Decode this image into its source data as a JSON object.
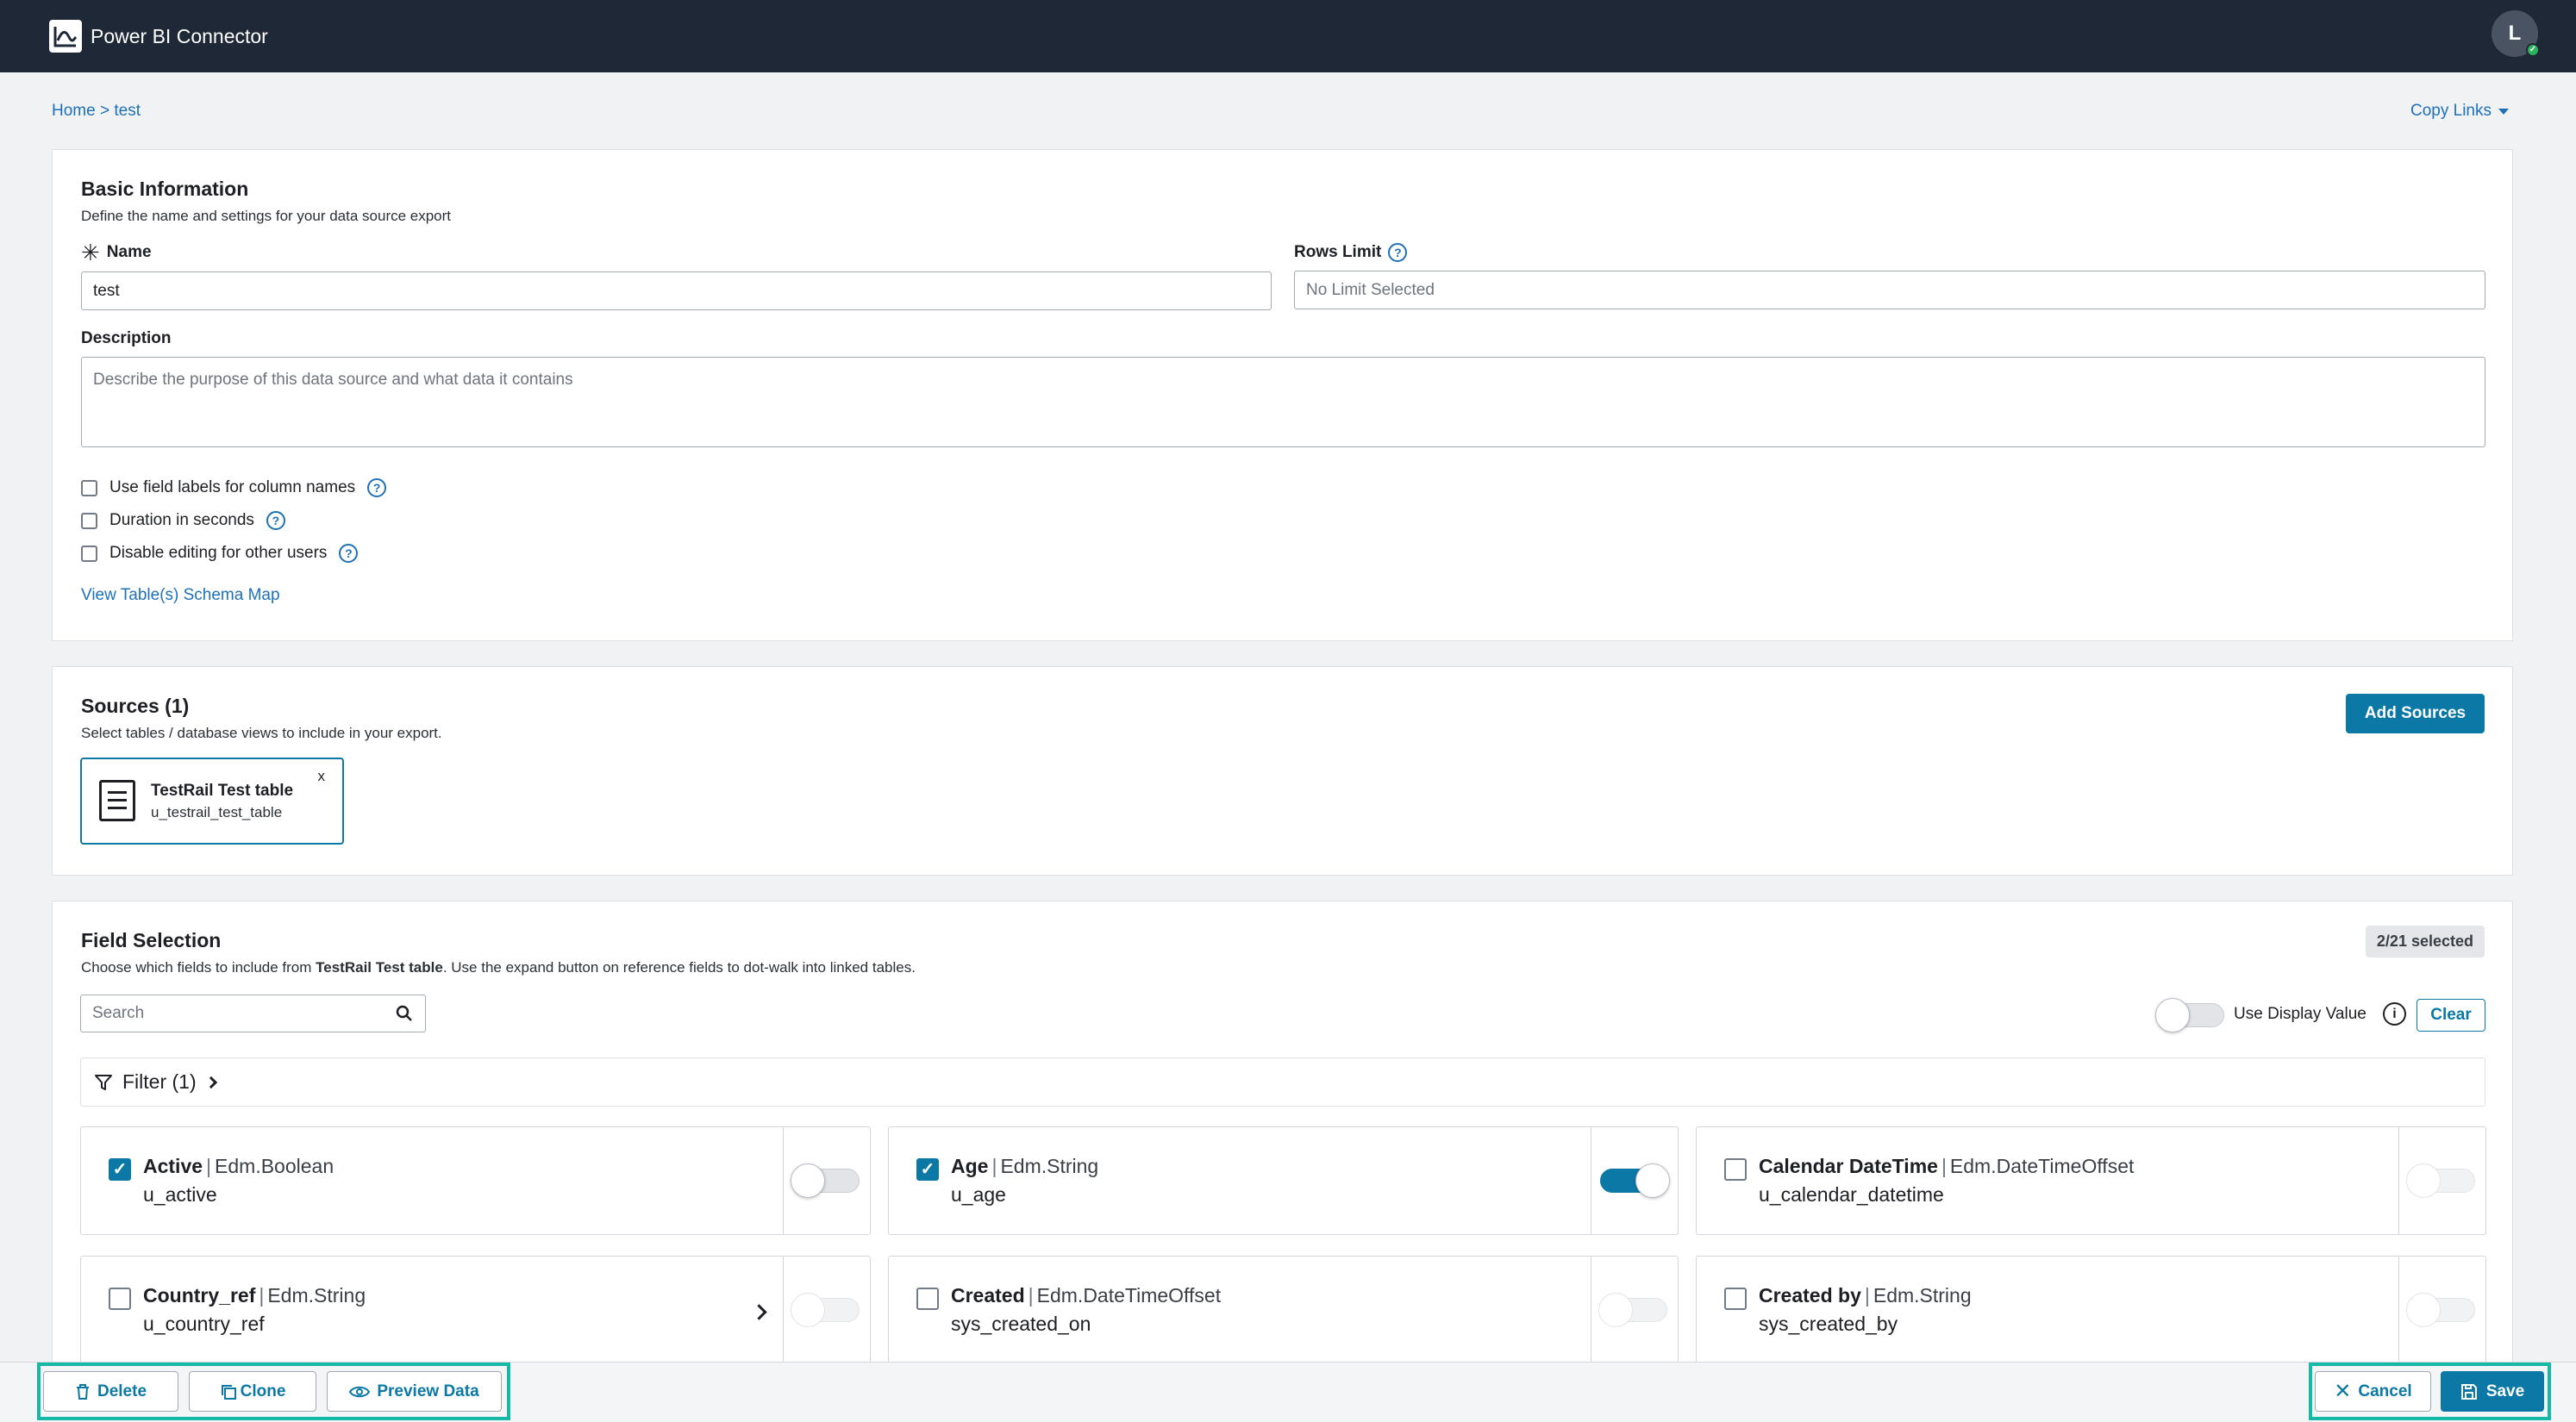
{
  "header": {
    "app_title": "Power BI Connector",
    "avatar_initial": "L"
  },
  "breadcrumb": {
    "home": "Home",
    "separator": ">",
    "current": "test"
  },
  "copy_links": "Copy Links",
  "basic_info": {
    "title": "Basic Information",
    "subtitle": "Define the name and settings for your data source export",
    "name_label": "Name",
    "name_value": "test",
    "rows_limit_label": "Rows Limit",
    "rows_limit_placeholder": "No Limit Selected",
    "description_label": "Description",
    "description_placeholder": "Describe the purpose of this data source and what data it contains",
    "options": [
      {
        "label": "Use field labels for column names",
        "checked": false
      },
      {
        "label": "Duration in seconds",
        "checked": false
      },
      {
        "label": "Disable editing for other users",
        "checked": false
      }
    ],
    "schema_link": "View Table(s) Schema Map"
  },
  "sources": {
    "title": "Sources (1)",
    "subtitle": "Select tables / database views to include in your export.",
    "add_button": "Add Sources",
    "items": [
      {
        "name": "TestRail Test table",
        "code": "u_testrail_test_table",
        "close": "x"
      }
    ]
  },
  "field_selection": {
    "title": "Field Selection",
    "subtitle_pre": "Choose which fields to include from ",
    "subtitle_table": "TestRail Test table",
    "subtitle_post": ". Use the expand button on reference fields to dot-walk into linked tables.",
    "selected_badge": "2/21 selected",
    "search_placeholder": "Search",
    "display_value_label": "Use Display Value",
    "clear_button": "Clear",
    "filter_label": "Filter (1)",
    "fields": [
      {
        "name": "Active",
        "type": "Edm.Boolean",
        "code": "u_active",
        "checked": true,
        "toggle": "off"
      },
      {
        "name": "Age",
        "type": "Edm.String",
        "code": "u_age",
        "checked": true,
        "toggle": "on"
      },
      {
        "name": "Calendar DateTime",
        "type": "Edm.DateTimeOffset",
        "code": "u_calendar_datetime",
        "checked": false,
        "toggle": "disabled"
      },
      {
        "name": "Country_ref",
        "type": "Edm.String",
        "code": "u_country_ref",
        "checked": false,
        "toggle": "disabled"
      },
      {
        "name": "Created",
        "type": "Edm.DateTimeOffset",
        "code": "sys_created_on",
        "checked": false,
        "toggle": "disabled"
      },
      {
        "name": "Created by",
        "type": "Edm.String",
        "code": "sys_created_by",
        "checked": false,
        "toggle": "disabled"
      }
    ],
    "type_separator": "|"
  },
  "footer": {
    "delete": "Delete",
    "clone": "Clone",
    "preview": "Preview Data",
    "cancel": "Cancel",
    "save": "Save"
  },
  "colors": {
    "accent": "#0b78a6",
    "topbar": "#1e2836",
    "highlight": "#16b8a6",
    "link": "#1e70b8"
  }
}
